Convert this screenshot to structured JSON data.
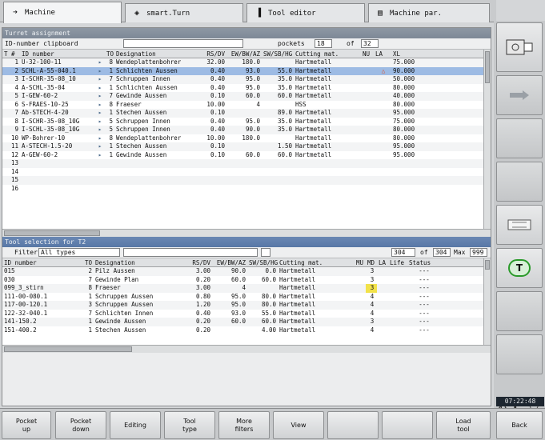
{
  "tabs": [
    {
      "label": "Machine",
      "icon": "machine-arrow-icon"
    },
    {
      "label": "smart.Turn",
      "icon": "smartturn-icon"
    },
    {
      "label": "Tool editor",
      "icon": "tool-editor-icon"
    },
    {
      "label": "Machine par.",
      "icon": "machine-par-icon"
    }
  ],
  "turret": {
    "title": "Turret assignment",
    "clipboard_label": "ID-number clipboard",
    "clipboard_value": "",
    "pockets_label": "pockets",
    "pockets_value": "18",
    "of_label": "of",
    "pockets_total": "32",
    "columns": [
      "T #",
      "ID number",
      "",
      "TO",
      "Designation",
      "RS/DV",
      "EW/BW/AZ",
      "SW/SB/HG",
      "Cutting mat.",
      "NU",
      "LA",
      "XL"
    ],
    "rows": [
      [
        "1",
        "U-32-100-11",
        "8",
        "Wendeplattenbohrer",
        "32.00",
        "180.0",
        "",
        "Hartmetall",
        "",
        "",
        "75.000"
      ],
      [
        "2",
        "SCHL-A-55-040.1",
        "1",
        "Schlichten Aussen",
        "0.40",
        "93.0",
        "55.0",
        "Hartmetall",
        "",
        "△",
        "90.000"
      ],
      [
        "3",
        "I-SCHR-35-08_10",
        "7",
        "Schruppen Innen",
        "0.40",
        "95.0",
        "35.0",
        "Hartmetall",
        "",
        "",
        "50.000"
      ],
      [
        "4",
        "A-SCHL-35-04",
        "1",
        "Schlichten Aussen",
        "0.40",
        "95.0",
        "35.0",
        "Hartmetall",
        "",
        "",
        "80.000"
      ],
      [
        "5",
        "I-GEW-60-2",
        "7",
        "Gewinde Aussen",
        "0.10",
        "60.0",
        "60.0",
        "Hartmetall",
        "",
        "",
        "40.000"
      ],
      [
        "6",
        "S-FRAES-10-25",
        "8",
        "Fraeser",
        "10.00",
        "4",
        "",
        "HSS",
        "",
        "",
        "80.000"
      ],
      [
        "7",
        "Ab-STECH-4-20",
        "1",
        "Stechen Aussen",
        "0.10",
        "",
        "89.0",
        "Hartmetall",
        "",
        "",
        "95.000"
      ],
      [
        "8",
        "I-SCHR-35-08_10G",
        "5",
        "Schruppen Innen",
        "0.40",
        "95.0",
        "35.0",
        "Hartmetall",
        "",
        "",
        "75.000"
      ],
      [
        "9",
        "I-SCHL-35-08_10G",
        "5",
        "Schruppen Innen",
        "0.40",
        "90.0",
        "35.0",
        "Hartmetall",
        "",
        "",
        "80.000"
      ],
      [
        "10",
        "WP-Bohrer-10",
        "8",
        "Wendeplattenbohrer",
        "10.00",
        "180.0",
        "",
        "Hartmetall",
        "",
        "",
        "80.000"
      ],
      [
        "11",
        "A-STECH-1.5-20",
        "1",
        "Stechen Aussen",
        "0.10",
        "",
        "1.50",
        "Hartmetall",
        "",
        "",
        "95.000"
      ],
      [
        "12",
        "A-GEW-60-2",
        "1",
        "Gewinde Aussen",
        "0.10",
        "60.0",
        "60.0",
        "Hartmetall",
        "",
        "",
        "95.000"
      ],
      [
        "13",
        "",
        "",
        "",
        "",
        "",
        "",
        "",
        "",
        "",
        ""
      ],
      [
        "14",
        "",
        "",
        "",
        "",
        "",
        "",
        "",
        "",
        "",
        ""
      ],
      [
        "15",
        "",
        "",
        "",
        "",
        "",
        "",
        "",
        "",
        "",
        ""
      ],
      [
        "16",
        "",
        "",
        "",
        "",
        "",
        "",
        "",
        "",
        "",
        ""
      ]
    ]
  },
  "selection": {
    "title": "Tool selection for T2",
    "filter_label": "Filter",
    "filter_value": "All types",
    "count": "304",
    "of_label": "of",
    "total": "304",
    "max_label": "Max",
    "max_value": "999",
    "columns": [
      "ID number",
      "TO",
      "Designation",
      "RS/DV",
      "EW/BW/AZ",
      "SW/SB/HG",
      "Cutting mat.",
      "MU",
      "MD",
      "LA",
      "Life",
      "Status"
    ],
    "rows": [
      [
        "015",
        "2",
        "Pilz Aussen",
        "3.00",
        "90.0",
        "0.0",
        "Hartmetall",
        "3",
        "---"
      ],
      [
        "030",
        "7",
        "Gewinde Plan",
        "0.20",
        "60.0",
        "60.0",
        "Hartmetall",
        "3",
        "---"
      ],
      [
        "099_3_stirn",
        "8",
        "Fraeser",
        "3.00",
        "4",
        "",
        "Hartmetall",
        "3",
        "---"
      ],
      [
        "111-00-080.1",
        "1",
        "Schruppen Aussen",
        "0.80",
        "95.0",
        "80.0",
        "Hartmetall",
        "4",
        "---"
      ],
      [
        "117-00-120.1",
        "3",
        "Schruppen Aussen",
        "1.20",
        "95.0",
        "80.0",
        "Hartmetall",
        "4",
        "---"
      ],
      [
        "122-32-040.1",
        "7",
        "Schlichten Innen",
        "0.40",
        "93.0",
        "55.0",
        "Hartmetall",
        "4",
        "---"
      ],
      [
        "141-150.2",
        "1",
        "Gewinde Aussen",
        "0.20",
        "60.0",
        "60.0",
        "Hartmetall",
        "3",
        "---"
      ],
      [
        "151-400.2",
        "1",
        "Stechen Aussen",
        "0.20",
        "",
        "4.00",
        "Hartmetall",
        "4",
        "---"
      ]
    ]
  },
  "softkeys_bottom": [
    "Pocket\nup",
    "Pocket\ndown",
    "Editing",
    "Tool\ntype",
    "More\nfilters",
    "View",
    "",
    "",
    "Load\ntool",
    "Back"
  ],
  "clock": "07:22:48",
  "colors": {
    "selected_row": "#9dbbe4",
    "blue_title": "#5877a6",
    "grey_title": "#7d8896",
    "highlight_md": "#f2e24a",
    "warning": "#e05030"
  }
}
